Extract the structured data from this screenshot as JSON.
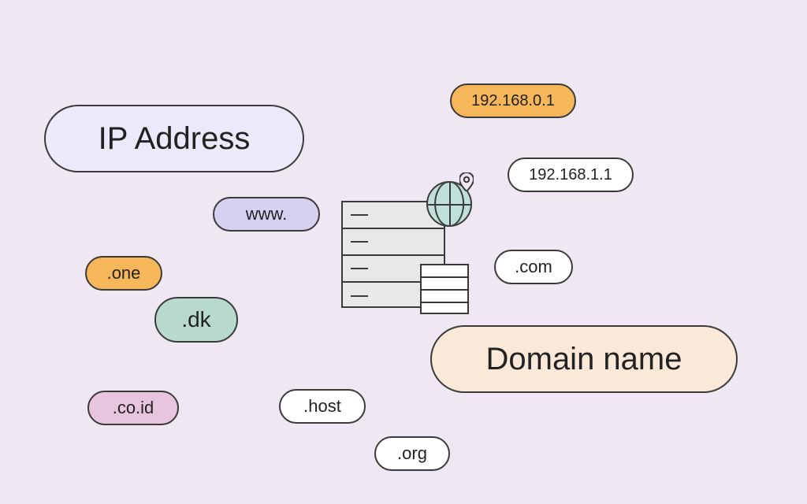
{
  "pills": {
    "ip_address": {
      "label": "IP Address",
      "bg": "#ece9fb"
    },
    "ip1": {
      "label": "192.168.0.1",
      "bg": "#f6b65a"
    },
    "ip2": {
      "label": "192.168.1.1",
      "bg": "#ffffff"
    },
    "www": {
      "label": "www.",
      "bg": "#d6d1f1"
    },
    "one": {
      "label": ".one",
      "bg": "#f6b65a"
    },
    "dk": {
      "label": ".dk",
      "bg": "#b7dacd"
    },
    "com": {
      "label": ".com",
      "bg": "#ffffff"
    },
    "domain_name": {
      "label": "Domain name",
      "bg": "#fae9d8"
    },
    "coid": {
      "label": ".co.id",
      "bg": "#e7c5de"
    },
    "host": {
      "label": ".host",
      "bg": "#ffffff"
    },
    "org": {
      "label": ".org",
      "bg": "#ffffff"
    }
  },
  "colors": {
    "background": "#efe8f2",
    "stroke": "#3a3a3a",
    "server_bg": "#e8e8e8",
    "globe_bg": "#bfe0d8"
  }
}
